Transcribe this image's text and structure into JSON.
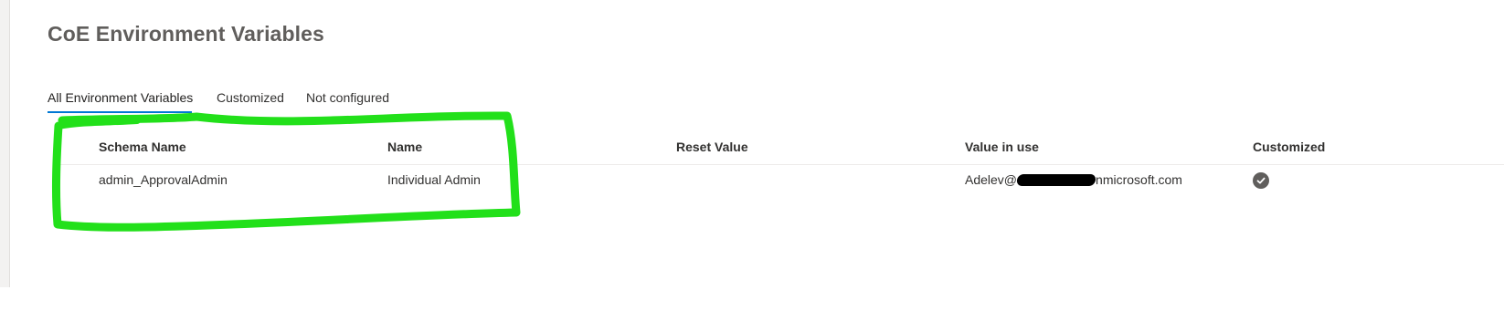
{
  "page": {
    "title": "CoE Environment Variables"
  },
  "tabs": [
    {
      "label": "All Environment Variables",
      "active": true
    },
    {
      "label": "Customized",
      "active": false
    },
    {
      "label": "Not configured",
      "active": false
    }
  ],
  "table": {
    "columns": [
      "Schema Name",
      "Name",
      "Reset Value",
      "Value in use",
      "Customized"
    ],
    "rows": [
      {
        "schema_name": "admin_ApprovalAdmin",
        "name": "Individual Admin",
        "reset_value": "",
        "value_in_use_prefix": "Adelev@",
        "value_in_use_suffix": "nmicrosoft.com",
        "customized": true,
        "customized_icon": "checkmark-circle-icon"
      }
    ]
  },
  "colors": {
    "accent": "#0078d4",
    "highlight_annotation": "#22e01a",
    "check_icon_bg": "#605e5c"
  }
}
